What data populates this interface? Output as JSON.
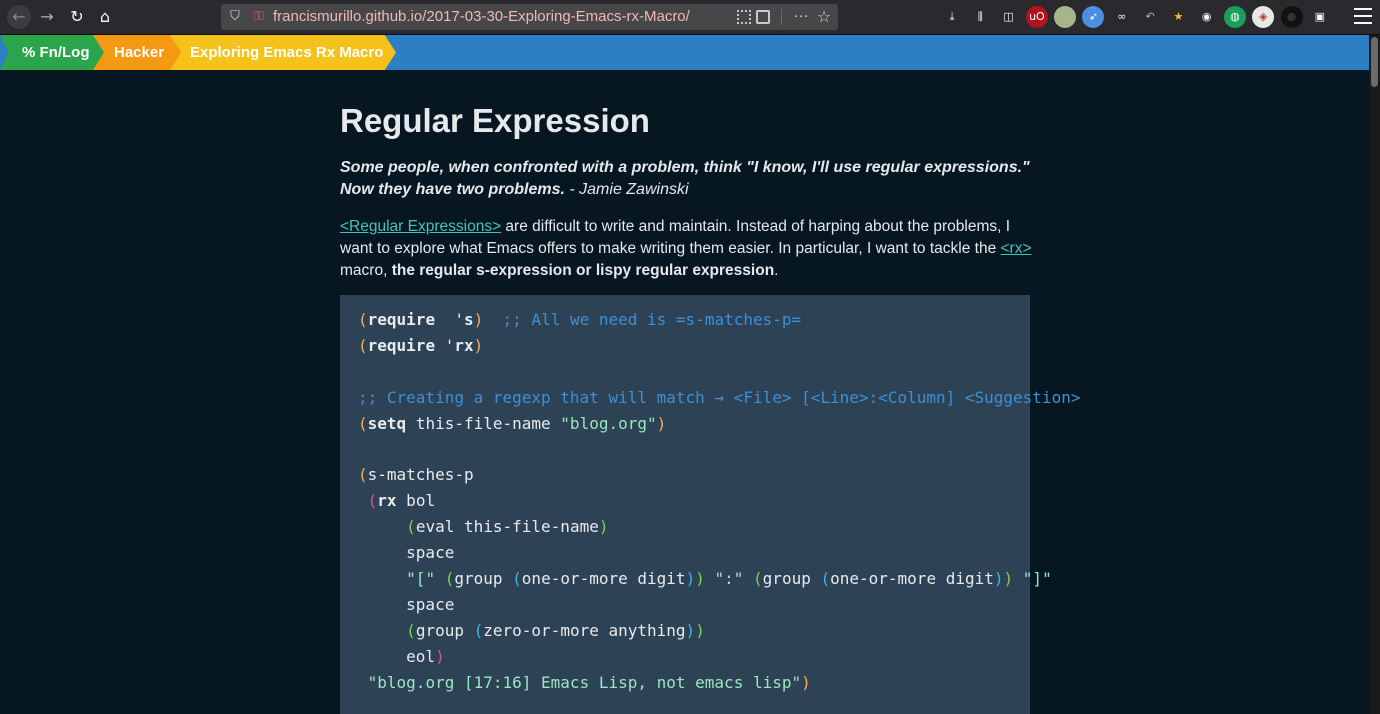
{
  "browser": {
    "url": "francismurillo.github.io/2017-03-30-Exploring-Emacs-rx-Macro/",
    "toolbar_icons": [
      {
        "name": "download-icon",
        "glyph": "⤓",
        "bg": "#2a2a2e",
        "fg": "#f9f9fa"
      },
      {
        "name": "library-icon",
        "glyph": "⫼",
        "bg": "#2a2a2e",
        "fg": "#f9f9fa"
      },
      {
        "name": "sidebar-icon",
        "glyph": "◫",
        "bg": "#2a2a2e",
        "fg": "#f9f9fa"
      },
      {
        "name": "ublock-origin-icon",
        "glyph": "uO",
        "bg": "#b3121f",
        "fg": "#ffffff"
      },
      {
        "name": "extension-green-icon",
        "glyph": "",
        "bg": "#a8b58a",
        "fg": "#ffffff"
      },
      {
        "name": "compass-extension-icon",
        "glyph": "➶",
        "bg": "#4a90e2",
        "fg": "#ffffff"
      },
      {
        "name": "glasses-extension-icon",
        "glyph": "∞",
        "bg": "#2a2a2e",
        "fg": "#f9f9fa"
      },
      {
        "name": "undo-extension-icon",
        "glyph": "↶",
        "bg": "#2a2a2e",
        "fg": "#b1b1b3"
      },
      {
        "name": "star-extension-icon",
        "glyph": "★",
        "bg": "#2a2a2e",
        "fg": "#f6c31b"
      },
      {
        "name": "account-icon",
        "glyph": "◉",
        "bg": "#2a2a2e",
        "fg": "#f9f9fa"
      },
      {
        "name": "globe-extension-icon",
        "glyph": "◍",
        "bg": "#1b9e5a",
        "fg": "#ffffff"
      },
      {
        "name": "cookie-extension-icon",
        "glyph": "◈",
        "bg": "#e8e8e8",
        "fg": "#c0392b"
      },
      {
        "name": "dark-extension-icon",
        "glyph": "●",
        "bg": "#111111",
        "fg": "#333333"
      },
      {
        "name": "screenshot-extension-icon",
        "glyph": "▣",
        "bg": "#2a2a2e",
        "fg": "#f9f9fa"
      }
    ]
  },
  "breadcrumb": {
    "items": [
      "% Fn/Log",
      "Hacker",
      "Exploring Emacs Rx Macro"
    ]
  },
  "article": {
    "heading": "Regular Expression",
    "quote": {
      "text": "Some people, when confronted with a problem, think \"I know, I'll use regular expressions.\" Now they have two problems.",
      "attribution": " - Jamie Zawinski"
    },
    "paragraph": {
      "link1": "<Regular Expressions>",
      "text1": " are difficult to write and maintain. Instead of harping about the problems, I want to explore what Emacs offers to make writing them easier. In particular, I want to tackle the ",
      "link2": "<rx>",
      "text2": " macro, ",
      "bold": "the regular s-expression or lispy regular expression",
      "text3": "."
    },
    "code_lines": [
      [
        [
          "p1",
          "("
        ],
        [
          "kw",
          "require"
        ],
        [
          "",
          "  '"
        ],
        [
          "kw",
          "s"
        ],
        [
          "p1",
          ")"
        ],
        [
          "",
          "  "
        ],
        [
          "cm",
          ";; All we need is =s-matches-p="
        ]
      ],
      [
        [
          "p1",
          "("
        ],
        [
          "kw",
          "require"
        ],
        [
          "",
          " '"
        ],
        [
          "kw",
          "rx"
        ],
        [
          "p1",
          ")"
        ]
      ],
      [],
      [
        [
          "cm",
          ";; Creating a regexp that will match → <File> [<Line>:<Column] <Suggestion>"
        ]
      ],
      [
        [
          "p1",
          "("
        ],
        [
          "kw",
          "setq"
        ],
        [
          "",
          " this-file-name "
        ],
        [
          "st",
          "\"blog.org\""
        ],
        [
          "p1",
          ")"
        ]
      ],
      [],
      [
        [
          "p1",
          "("
        ],
        [
          "",
          "s-matches-p"
        ]
      ],
      [
        [
          "",
          " "
        ],
        [
          "p2",
          "("
        ],
        [
          "kw",
          "rx"
        ],
        [
          "",
          " bol"
        ]
      ],
      [
        [
          "",
          "     "
        ],
        [
          "p3",
          "("
        ],
        [
          "",
          "eval this-file-name"
        ],
        [
          "p3",
          ")"
        ]
      ],
      [
        [
          "",
          "     space"
        ]
      ],
      [
        [
          "",
          "     "
        ],
        [
          "st",
          "\"[\""
        ],
        [
          "",
          " "
        ],
        [
          "p3",
          "("
        ],
        [
          "",
          "group "
        ],
        [
          "p4",
          "("
        ],
        [
          "",
          "one-or-more digit"
        ],
        [
          "p4",
          ")"
        ],
        [
          "p3",
          ")"
        ],
        [
          "",
          " "
        ],
        [
          "st",
          "\":\""
        ],
        [
          "",
          " "
        ],
        [
          "p3",
          "("
        ],
        [
          "",
          "group "
        ],
        [
          "p4",
          "("
        ],
        [
          "",
          "one-or-more digit"
        ],
        [
          "p4",
          ")"
        ],
        [
          "p3",
          ")"
        ],
        [
          "",
          " "
        ],
        [
          "st",
          "\"]\""
        ]
      ],
      [
        [
          "",
          "     space"
        ]
      ],
      [
        [
          "",
          "     "
        ],
        [
          "p3",
          "("
        ],
        [
          "",
          "group "
        ],
        [
          "p4",
          "("
        ],
        [
          "",
          "zero-or-more anything"
        ],
        [
          "p4",
          ")"
        ],
        [
          "p3",
          ")"
        ]
      ],
      [
        [
          "",
          "     eol"
        ],
        [
          "p2",
          ")"
        ]
      ],
      [
        [
          "",
          " "
        ],
        [
          "st",
          "\"blog.org [17:16] Emacs Lisp, not emacs lisp\""
        ],
        [
          "p1",
          ")"
        ]
      ]
    ]
  }
}
